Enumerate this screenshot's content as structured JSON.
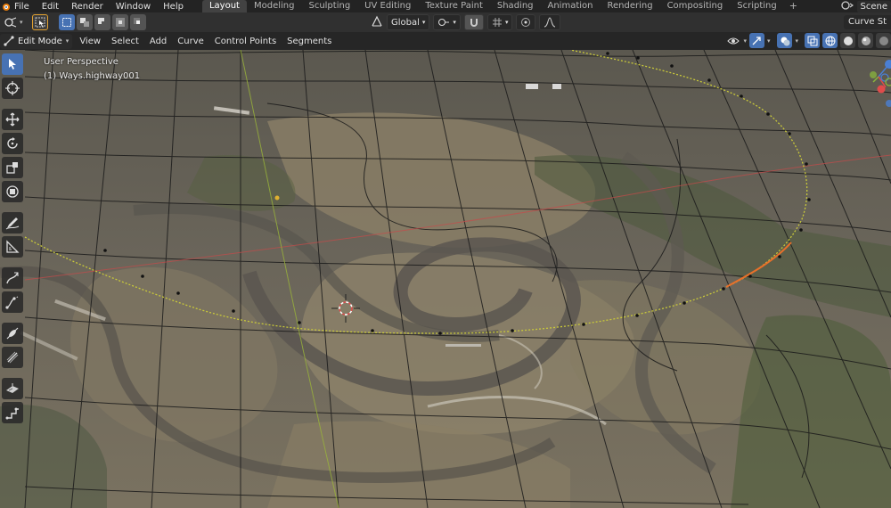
{
  "topbar": {
    "menus": [
      "File",
      "Edit",
      "Render",
      "Window",
      "Help"
    ],
    "workspace_tabs": [
      {
        "label": "Layout",
        "active": true
      },
      {
        "label": "Modeling",
        "active": false
      },
      {
        "label": "Sculpting",
        "active": false
      },
      {
        "label": "UV Editing",
        "active": false
      },
      {
        "label": "Texture Paint",
        "active": false
      },
      {
        "label": "Shading",
        "active": false
      },
      {
        "label": "Animation",
        "active": false
      },
      {
        "label": "Rendering",
        "active": false
      },
      {
        "label": "Compositing",
        "active": false
      },
      {
        "label": "Scripting",
        "active": false
      }
    ],
    "add_tab": "+",
    "scene_label": "Scene"
  },
  "tool_header": {
    "orientation": "Global",
    "right_label": "Curve St"
  },
  "viewport_header": {
    "mode": "Edit Mode",
    "menus": [
      "View",
      "Select",
      "Add",
      "Curve",
      "Control Points",
      "Segments"
    ]
  },
  "viewport": {
    "perspective_label": "User Perspective",
    "object_label": "(1) Ways.highway001"
  },
  "toolbar": {
    "tools": [
      {
        "name": "select-box-tool",
        "icon": "cursor-icon",
        "active": true
      },
      {
        "name": "cursor-tool",
        "icon": "crosshair-icon",
        "active": false
      },
      {
        "name": "move-tool",
        "icon": "move-icon",
        "active": false
      },
      {
        "name": "rotate-tool",
        "icon": "rotate-icon",
        "active": false
      },
      {
        "name": "scale-tool",
        "icon": "scale-icon",
        "active": false
      },
      {
        "name": "transform-tool",
        "icon": "transform-icon",
        "active": false
      },
      {
        "name": "annotate-tool",
        "icon": "pencil-icon",
        "active": false
      },
      {
        "name": "measure-tool",
        "icon": "ruler-icon",
        "active": false
      },
      {
        "name": "draw-tool",
        "icon": "draw-curve-icon",
        "active": false
      },
      {
        "name": "extrude-tool",
        "icon": "extrude-icon",
        "active": false
      },
      {
        "name": "radius-tool",
        "icon": "radius-icon",
        "active": false
      },
      {
        "name": "tilt-tool",
        "icon": "tilt-icon",
        "active": false
      },
      {
        "name": "randomize-tool",
        "icon": "randomize-icon",
        "active": false
      },
      {
        "name": "shear-tool",
        "icon": "shear-icon",
        "active": false
      }
    ]
  },
  "colors": {
    "accent": "#4772b3",
    "curve": "#c9c93a",
    "curve_selected": "#e8702a",
    "axis_x": "#e04b4b",
    "axis_y": "#8ab53c",
    "axis_z": "#4a7fd4"
  }
}
